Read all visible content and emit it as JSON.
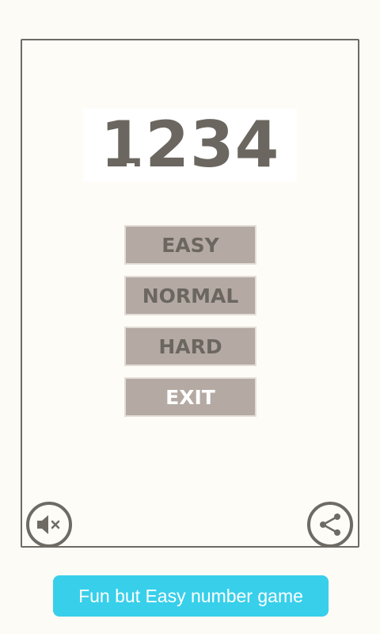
{
  "app": {
    "logo_text": "1234"
  },
  "menu": {
    "easy_label": "EASY",
    "normal_label": "NORMAL",
    "hard_label": "HARD",
    "exit_label": "EXIT"
  },
  "icons": {
    "mute": "speaker-muted-icon",
    "share": "share-icon"
  },
  "banner": {
    "text": "Fun but Easy number game"
  },
  "colors": {
    "background": "#fdfbf5",
    "frame_border": "#6e6a64",
    "button_fill": "#b4aaa3",
    "button_text": "#6b6760",
    "exit_text": "#ffffff",
    "banner_fill": "#38cfea"
  }
}
